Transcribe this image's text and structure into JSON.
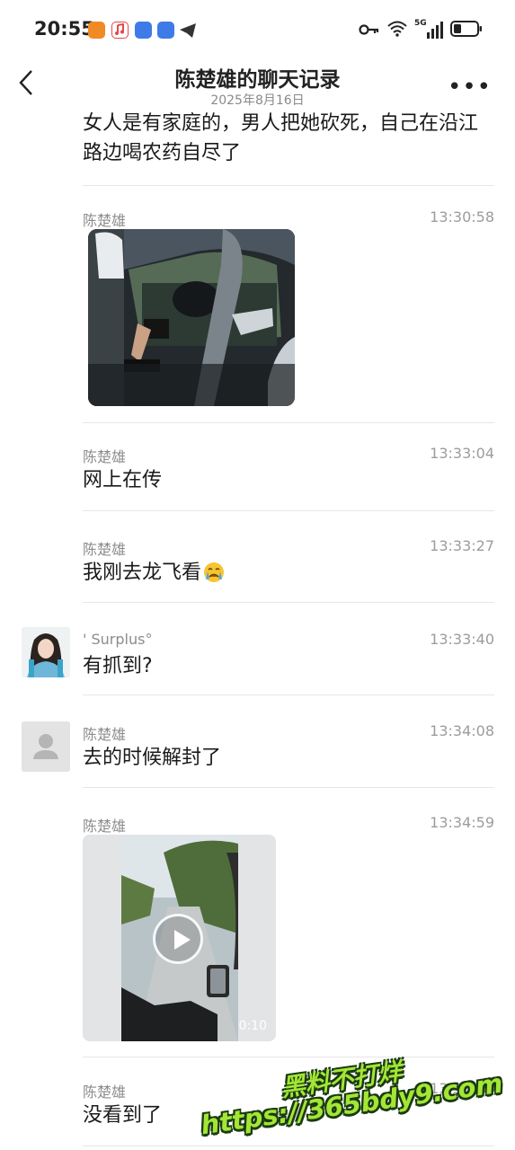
{
  "status_bar": {
    "time": "20:55",
    "network": "5G"
  },
  "header": {
    "title": "陈楚雄的聊天记录",
    "subtitle": "2025年8月16日"
  },
  "messages": [
    {
      "sender": "",
      "time": "",
      "text": "女人是有家庭的，男人把她砍死，自己在沿江路边喝农药自尽了"
    },
    {
      "sender": "陈楚雄",
      "time": "13:30:58",
      "text": ""
    },
    {
      "sender": "陈楚雄",
      "time": "13:33:04",
      "text": "网上在传"
    },
    {
      "sender": "陈楚雄",
      "time": "13:33:27",
      "text": "我刚去龙飞看"
    },
    {
      "sender": "' Surplus°",
      "time": "13:33:40",
      "text": "有抓到?"
    },
    {
      "sender": "陈楚雄",
      "time": "13:34:08",
      "text": "去的时候解封了"
    },
    {
      "sender": "陈楚雄",
      "time": "13:34:59",
      "text": ""
    },
    {
      "sender": "陈楚雄",
      "time": "13:35:38",
      "text": "没看到了"
    }
  ],
  "video": {
    "duration": "0:10"
  },
  "watermark": {
    "line1": "黑料不打烊",
    "line2": "https://365bdy9.com"
  },
  "colors": {
    "background": "#ffffff",
    "meta_text": "#8c8c8c",
    "divider": "#e6e6e6",
    "watermark": "#a3e635"
  }
}
